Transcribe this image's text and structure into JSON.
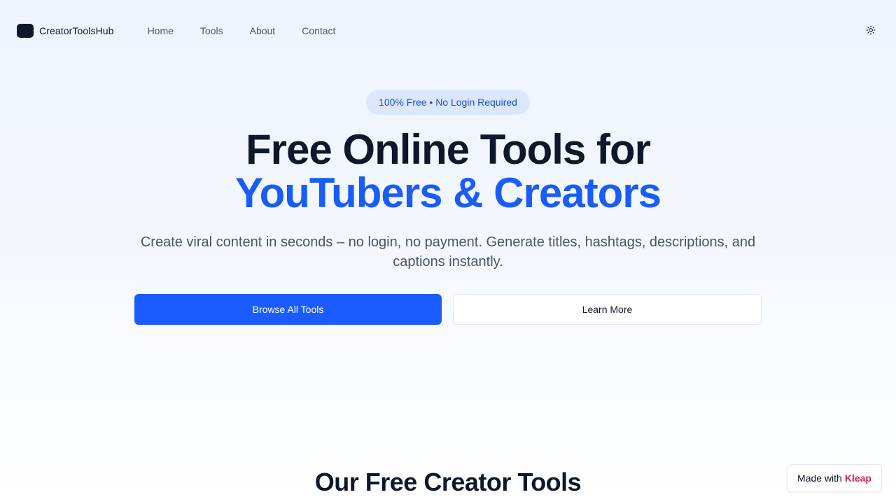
{
  "nav": {
    "brand": "CreatorToolsHub",
    "links": [
      {
        "label": "Home"
      },
      {
        "label": "Tools"
      },
      {
        "label": "About"
      },
      {
        "label": "Contact"
      }
    ],
    "theme_toggle_icon": "sun-icon"
  },
  "hero": {
    "badge": "100% Free • No Login Required",
    "title_line1": "Free Online Tools for",
    "title_line2": "YouTubers & Creators",
    "subtitle": "Create viral content in seconds – no login, no payment. Generate titles, hashtags, descriptions, and captions instantly.",
    "primary_button": "Browse All Tools",
    "secondary_button": "Learn More"
  },
  "tools_section": {
    "title": "Our Free Creator Tools"
  },
  "made_with": {
    "prefix": "Made with",
    "brand": "Kleap"
  },
  "colors": {
    "accent": "#1a5cff",
    "heading_accent": "#1a5cf7",
    "badge_bg": "#dbe7fd",
    "brand_pink": "#e11d48"
  }
}
